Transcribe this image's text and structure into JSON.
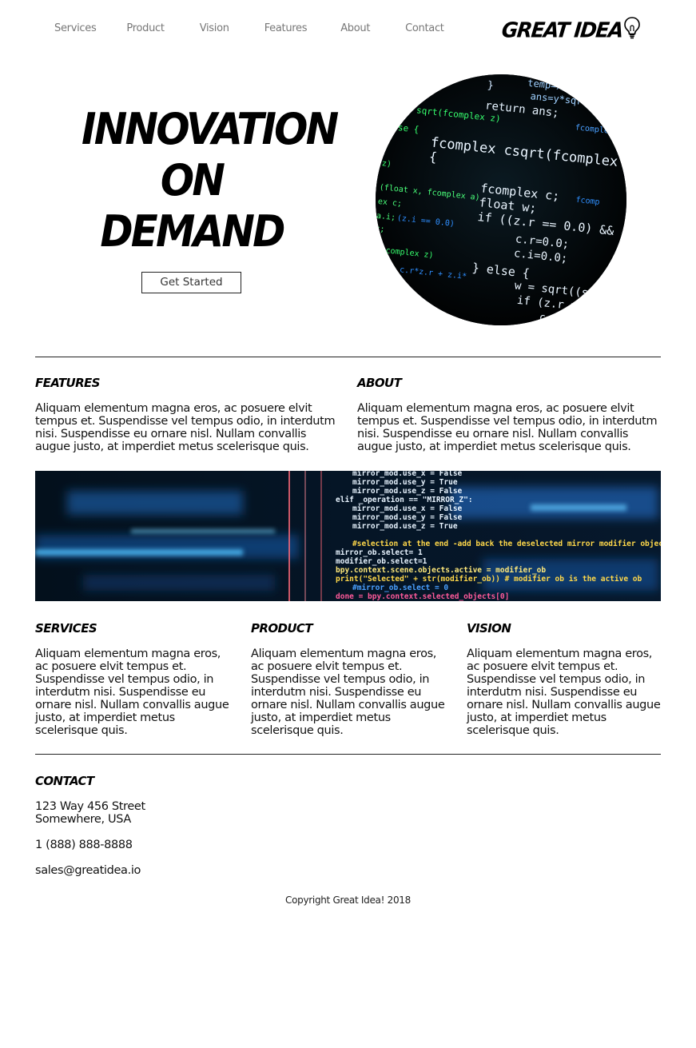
{
  "nav": {
    "items": [
      "Services",
      "Product",
      "Vision",
      "Features",
      "About",
      "Contact"
    ]
  },
  "logo": {
    "text": "GREAT IDEA",
    "icon": "lightbulb-icon"
  },
  "hero": {
    "title_lines": [
      "INNOVATION",
      "ON",
      "DEMAND"
    ],
    "cta_label": "Get Started",
    "image_icon": "code-screen-image"
  },
  "features": {
    "title": "FEATURES",
    "body": "Aliquam elementum magna eros, ac posuere elvit tempus et. Suspendisse vel tempus odio, in interdutm nisi. Suspendisse eu ornare nisl. Nullam convallis augue justo, at imperdiet metus scelerisque quis."
  },
  "about": {
    "title": "ABOUT",
    "body": "Aliquam elementum magna eros, ac posuere elvit tempus et. Suspendisse vel tempus odio, in interdutm nisi. Suspendisse eu ornare nisl. Nullam convallis augue justo, at imperdiet metus scelerisque quis."
  },
  "banner": {
    "code_lines": [
      "mirror_mod.use_x = False",
      "mirror_mod.use_y = True",
      "mirror_mod.use_z = False",
      "elif _operation == \"MIRROR_Z\":",
      "mirror_mod.use_x = False",
      "mirror_mod.use_y = False",
      "mirror_mod.use_z = True",
      "",
      "#selection at the end -add back the deselected mirror modifier object",
      "mirror_ob.select= 1",
      "modifier_ob.select=1",
      "bpy.context.scene.objects.active = modifier_ob",
      "print(\"Selected\" + str(modifier_ob)) # modifier ob is the active ob",
      "#mirror_ob.select = 0",
      "done = bpy.context.selected_objects[0]"
    ]
  },
  "services": {
    "title": "SERVICES",
    "body": "Aliquam elementum magna eros, ac posuere elvit tempus et. Suspendisse vel tempus odio, in interdutm nisi. Suspendisse eu ornare nisl. Nullam convallis augue justo, at imperdiet metus scelerisque quis."
  },
  "product": {
    "title": "PRODUCT",
    "body": "Aliquam elementum magna eros, ac posuere elvit tempus et. Suspendisse vel tempus odio, in interdutm nisi. Suspendisse eu ornare nisl. Nullam convallis augue justo, at imperdiet metus scelerisque quis."
  },
  "vision": {
    "title": "VISION",
    "body": "Aliquam elementum magna eros, ac posuere elvit tempus et. Suspendisse vel tempus odio, in interdutm nisi. Suspendisse eu ornare nisl. Nullam convallis augue justo, at imperdiet metus scelerisque quis."
  },
  "contact": {
    "title": "CONTACT",
    "address_line1": "123 Way 456 Street",
    "address_line2": "Somewhere, USA",
    "phone": "1 (888) 888-8888",
    "email": "sales@greatidea.io"
  },
  "footer": {
    "copyright": "Copyright Great Idea! 2018"
  },
  "colors": {
    "code_green": "#4cff7a",
    "code_white": "#e8f4ff",
    "code_blue": "#2f8fff",
    "code_yellow": "#ffd84a",
    "code_pink": "#ff5a9a"
  }
}
